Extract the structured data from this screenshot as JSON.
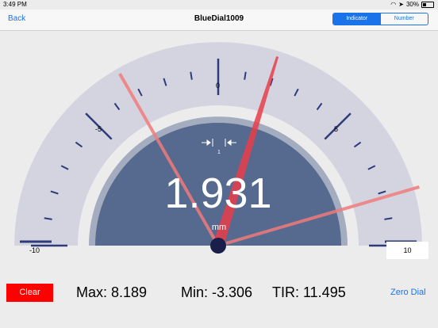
{
  "status_bar": {
    "time": "3:49 PM",
    "battery": "30%",
    "battery_level": 0.3
  },
  "nav": {
    "back": "Back",
    "title": "BlueDial1009",
    "segments": [
      "Indicator",
      "Number"
    ],
    "selected": "Indicator"
  },
  "dial": {
    "labels": {
      "minus10": "-10",
      "minus5": "-5",
      "zero": "0",
      "plus5": "5",
      "plus10": "10"
    },
    "reading": "1.931",
    "unit": "mm",
    "resolution_label": "1",
    "value": 1.931,
    "max": 8.189,
    "min": -3.306,
    "range": 10
  },
  "bottom": {
    "clear": "Clear",
    "max": "Max: 8.189",
    "min": "Min: -3.306",
    "tir": "TIR: 11.495",
    "zero_dial": "Zero Dial"
  },
  "colors": {
    "accent": "#1a73e8",
    "clear_button": "#ff0000",
    "needle": "#e83e4a",
    "marker": "#ee7b7b",
    "dial_face": "#56698f",
    "tick": "#2d3b7a"
  }
}
